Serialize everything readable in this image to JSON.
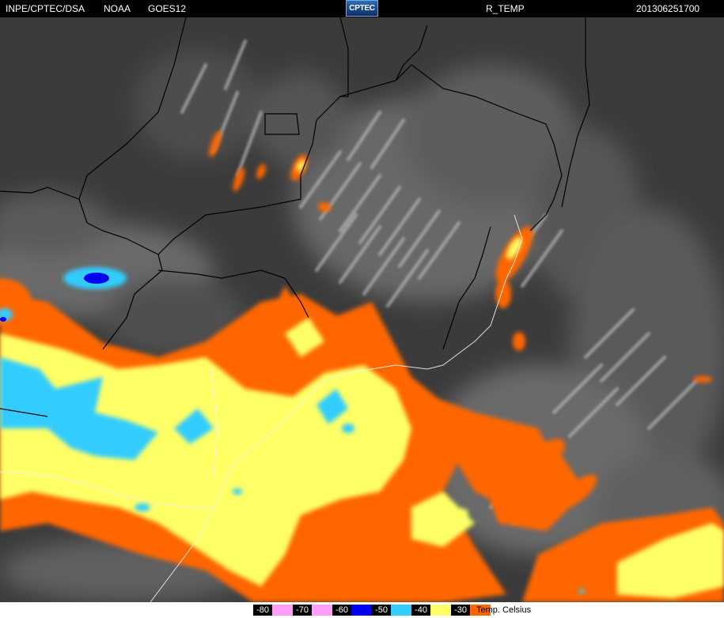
{
  "header": {
    "source": "INPE/CPTEC/DSA",
    "agency": "NOAA",
    "satellite": "GOES12",
    "logo_text": "CPTEC",
    "product": "R_TEMP",
    "timestamp": "201306251700"
  },
  "legend": {
    "unit_label": "Temp. Celsius",
    "entries": [
      {
        "label": "-80",
        "color": "#ff9ff8",
        "text_color": "#ffffff"
      },
      {
        "label": "-70",
        "color": "#ff9ff8",
        "text_color": "#000000"
      },
      {
        "label": "-60",
        "color": "#0000f0",
        "text_color": "#ffffff"
      },
      {
        "label": "-50",
        "color": "#33ccff",
        "text_color": "#000000"
      },
      {
        "label": "-40",
        "color": "#ffff66",
        "text_color": "#000000"
      },
      {
        "label": "-30",
        "color": "#ff6600",
        "text_color": "#000000"
      }
    ]
  },
  "map": {
    "type": "infrared satellite image",
    "coastline_color": "#000000",
    "border_color": "#ffffff",
    "cloud_classes": [
      "-60",
      "-50",
      "-40",
      "-30"
    ]
  }
}
